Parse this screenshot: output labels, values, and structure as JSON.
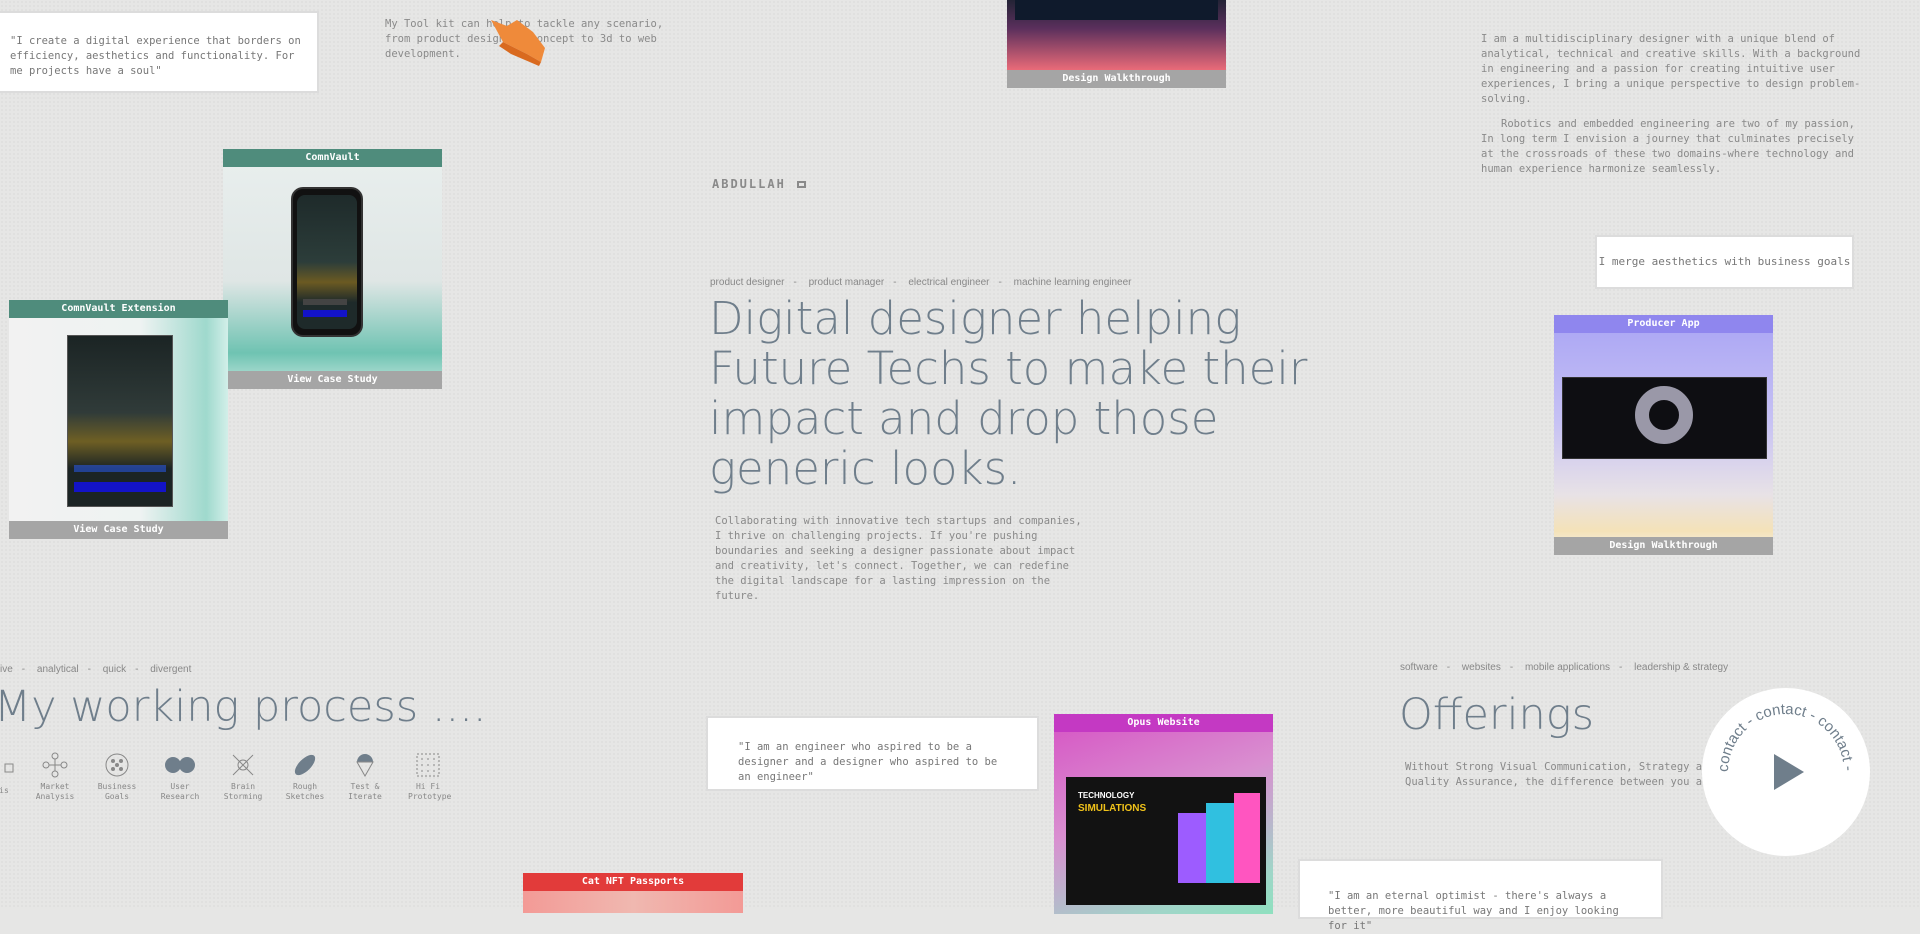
{
  "quotes": {
    "soul": "\"I create a digital experience that borders on efficiency, aesthetics and functionality. For me projects have a soul\"",
    "merge": "I merge aesthetics with business goals",
    "engineer": "\"I am an engineer who aspired to be a designer and a designer who aspired to be an engineer\"",
    "optimist": "\"I am an eternal optimist - there's always a better, more beautiful way and I enjoy looking for it\""
  },
  "toolkit_text": "My Tool kit can help to tackle any scenario, from product design to concept to 3d to web development.",
  "about": {
    "p1": "I am a multidisciplinary designer with a unique blend of analytical, technical and creative skills. With a background in engineering and a passion for creating intuitive user experiences, I bring a unique perspective to design problem-solving.",
    "p2": "Robotics and embedded engineering are two of my passion, In long term I envision a journey that culminates precisely at the crossroads of these two domains-where technology and human experience harmonize seamlessly."
  },
  "logo_text": "ABDULLAH",
  "hero": {
    "roles": [
      "product designer",
      "product manager",
      "electrical engineer",
      "machine learning engineer"
    ],
    "title": "Digital designer helping Future Techs to make their impact and drop those generic looks.",
    "body": "Collaborating with innovative tech startups and companies, I thrive on challenging projects. If you're pushing boundaries and seeking a designer passionate about impact and creativity, let's connect. Together, we can redefine the digital landscape for a lasting impression on the future."
  },
  "cards": {
    "design_top": {
      "footer": "Design Walkthrough"
    },
    "comnvault": {
      "title": "ComnVault",
      "footer": "View Case Study"
    },
    "comnvault_ext": {
      "title": "ComnVault Extension",
      "footer": "View Case Study"
    },
    "producer": {
      "title": "Producer App",
      "footer": "Design Walkthrough"
    },
    "opus": {
      "title": "Opus Website"
    },
    "cat": {
      "title": "Cat NFT Passports"
    }
  },
  "process": {
    "tags": [
      "ive",
      "analytical",
      "quick",
      "divergent"
    ],
    "title": "My working process ....",
    "steps": [
      {
        "label": "is",
        "icon": "square-icon"
      },
      {
        "label": "Market Analysis",
        "icon": "network-icon"
      },
      {
        "label": "Business Goals",
        "icon": "dots-circle-icon"
      },
      {
        "label": "User Research",
        "icon": "double-circle-icon"
      },
      {
        "label": "Brain Storming",
        "icon": "burst-icon"
      },
      {
        "label": "Rough Sketches",
        "icon": "diagonal-ellipse-icon"
      },
      {
        "label": "Test & Iterate",
        "icon": "pin-icon"
      },
      {
        "label": "Hi Fi Prototype",
        "icon": "grid-icon"
      }
    ]
  },
  "offerings": {
    "tags": [
      "software",
      "websites",
      "mobile applications",
      "leadership & strategy"
    ],
    "title": "Offerings",
    "body": "Without Strong Visual Communication, Strategy and Quality Assurance, the difference between you and everyone else"
  },
  "contact": {
    "label": "contact"
  },
  "colors": {
    "background": "#e6e6e5",
    "teal": "#4f8c7c",
    "purple": "#8f86ee",
    "magenta": "#c439c3",
    "red": "#e23b3a",
    "heading": "#6f7e8b"
  }
}
